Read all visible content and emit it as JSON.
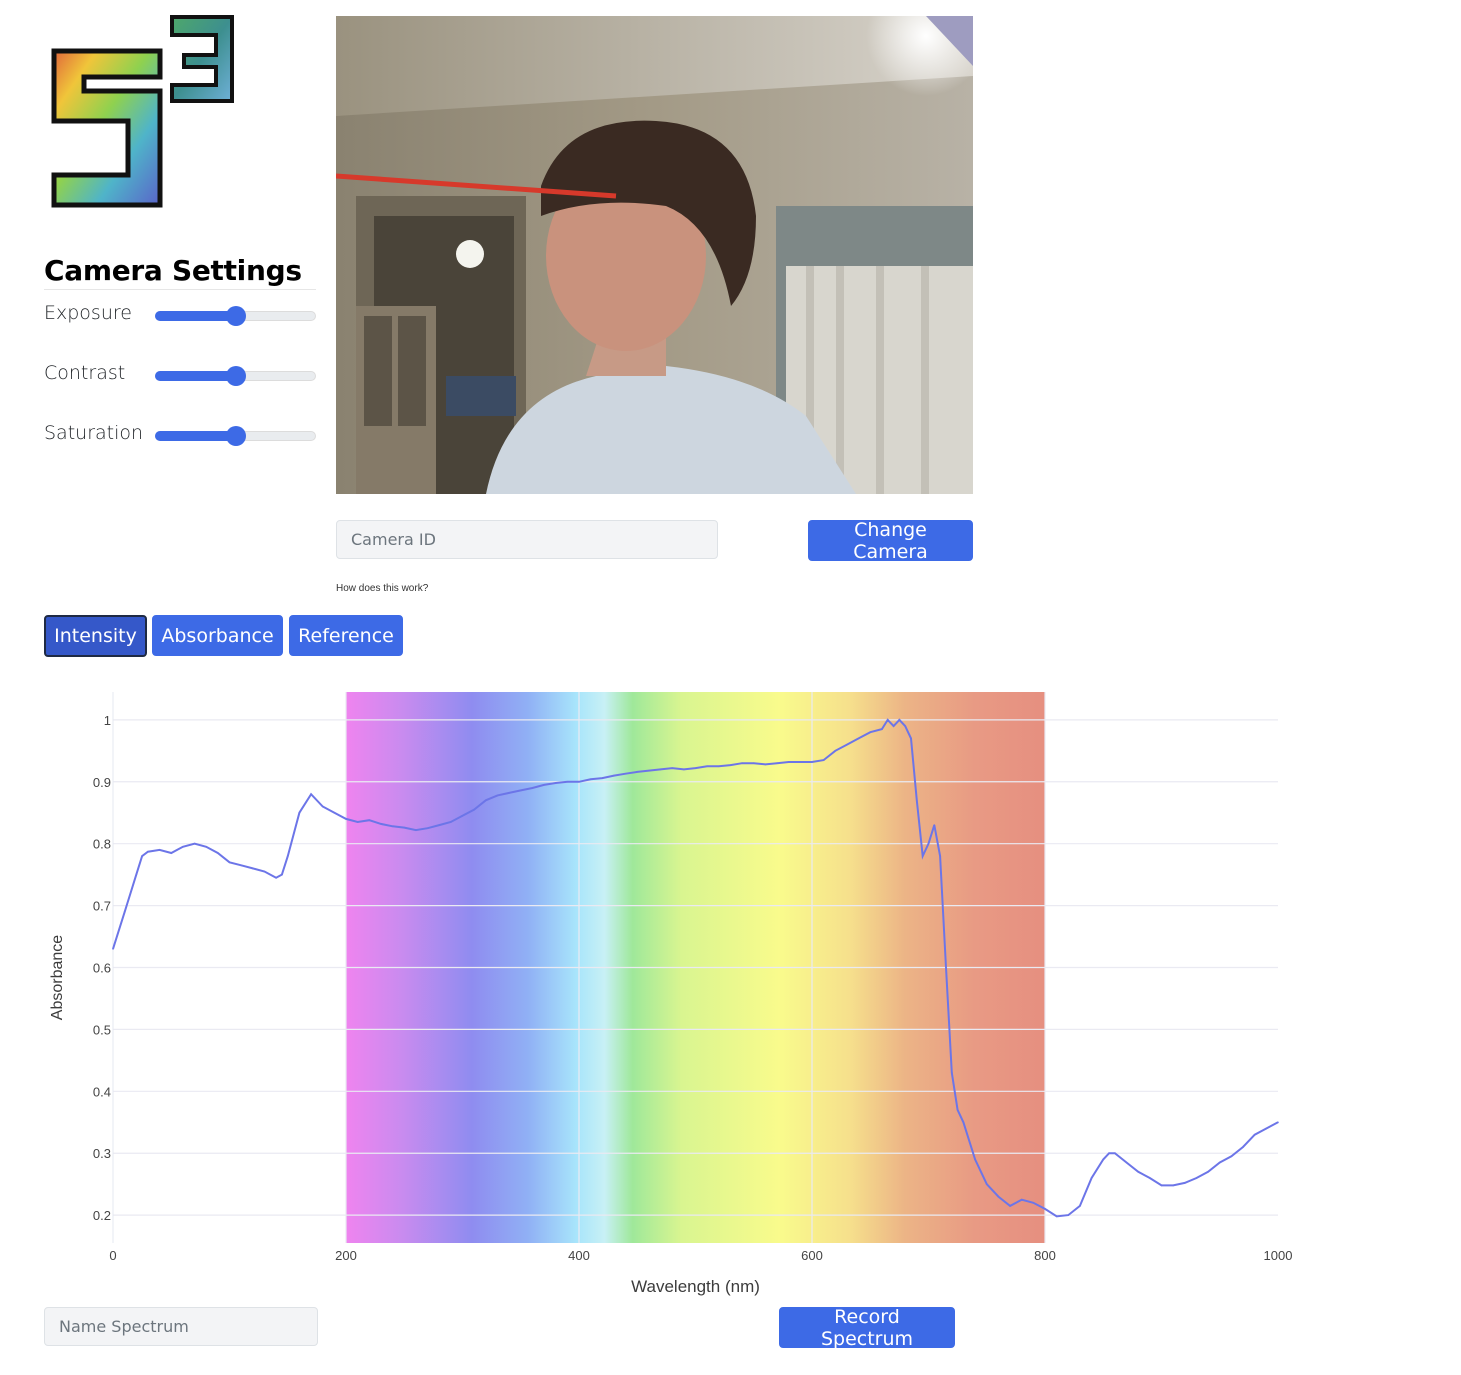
{
  "logo": {
    "alt": "S3 logo"
  },
  "camera_settings": {
    "title": "Camera Settings",
    "sliders": [
      {
        "label": "Exposure",
        "value": 0.5
      },
      {
        "label": "Contrast",
        "value": 0.5
      },
      {
        "label": "Saturation",
        "value": 0.5
      }
    ]
  },
  "camera": {
    "id_placeholder": "Camera ID",
    "change_button": "Change Camera",
    "how_link": "How does this work?"
  },
  "tabs": [
    {
      "label": "Intensity",
      "active": true
    },
    {
      "label": "Absorbance",
      "active": false
    },
    {
      "label": "Reference",
      "active": false
    }
  ],
  "spectrum": {
    "name_placeholder": "Name Spectrum",
    "record_button": "Record Spectrum"
  },
  "colors": {
    "accent": "#3d6ae6",
    "active_tab": "#3558c9",
    "line": "#6c75e8"
  },
  "chart_data": {
    "type": "line",
    "title": "",
    "xlabel": "Wavelength (nm)",
    "ylabel": "Absorbance",
    "xlim": [
      0,
      1000
    ],
    "ylim": [
      0.155,
      1.045
    ],
    "x_ticks": [
      0,
      200,
      400,
      600,
      800,
      1000
    ],
    "y_ticks": [
      0.2,
      0.3,
      0.4,
      0.5,
      0.6,
      0.7,
      0.8,
      0.9,
      1
    ],
    "grid": true,
    "background_band": {
      "from": 200,
      "to": 800,
      "description": "visible spectrum gradient"
    },
    "series": [
      {
        "x": [
          0,
          10,
          20,
          25,
          30,
          40,
          50,
          55,
          60,
          70,
          80,
          90,
          100,
          110,
          120,
          130,
          140,
          145,
          150,
          160,
          170,
          180,
          190,
          200,
          210,
          220,
          230,
          240,
          250,
          260,
          270,
          280,
          290,
          300,
          310,
          320,
          330,
          340,
          350,
          360,
          370,
          380,
          390,
          400,
          410,
          420,
          430,
          440,
          450,
          460,
          470,
          480,
          490,
          500,
          510,
          520,
          530,
          540,
          550,
          560,
          570,
          580,
          590,
          600,
          610,
          620,
          630,
          640,
          650,
          660,
          665,
          670,
          675,
          680,
          685,
          690,
          695,
          700,
          705,
          710,
          715,
          720,
          725,
          730,
          740,
          750,
          760,
          770,
          780,
          790,
          800,
          810,
          820,
          830,
          840,
          850,
          855,
          860,
          870,
          880,
          890,
          900,
          910,
          920,
          930,
          940,
          950,
          960,
          970,
          980,
          990,
          1000
        ],
        "y": [
          0.63,
          0.69,
          0.75,
          0.78,
          0.787,
          0.79,
          0.785,
          0.79,
          0.795,
          0.8,
          0.795,
          0.785,
          0.77,
          0.765,
          0.76,
          0.755,
          0.745,
          0.75,
          0.78,
          0.85,
          0.88,
          0.86,
          0.85,
          0.84,
          0.835,
          0.838,
          0.832,
          0.828,
          0.826,
          0.822,
          0.825,
          0.83,
          0.835,
          0.845,
          0.855,
          0.87,
          0.878,
          0.882,
          0.886,
          0.89,
          0.895,
          0.898,
          0.9,
          0.9,
          0.904,
          0.906,
          0.91,
          0.913,
          0.916,
          0.918,
          0.92,
          0.922,
          0.92,
          0.922,
          0.925,
          0.925,
          0.927,
          0.93,
          0.93,
          0.928,
          0.93,
          0.932,
          0.932,
          0.932,
          0.935,
          0.95,
          0.96,
          0.97,
          0.98,
          0.985,
          1.0,
          0.99,
          1.0,
          0.99,
          0.97,
          0.87,
          0.78,
          0.8,
          0.83,
          0.78,
          0.6,
          0.43,
          0.37,
          0.35,
          0.29,
          0.25,
          0.23,
          0.215,
          0.225,
          0.22,
          0.21,
          0.198,
          0.2,
          0.215,
          0.26,
          0.29,
          0.3,
          0.3,
          0.285,
          0.27,
          0.26,
          0.248,
          0.248,
          0.252,
          0.26,
          0.27,
          0.285,
          0.295,
          0.31,
          0.33,
          0.34,
          0.35
        ]
      }
    ]
  }
}
